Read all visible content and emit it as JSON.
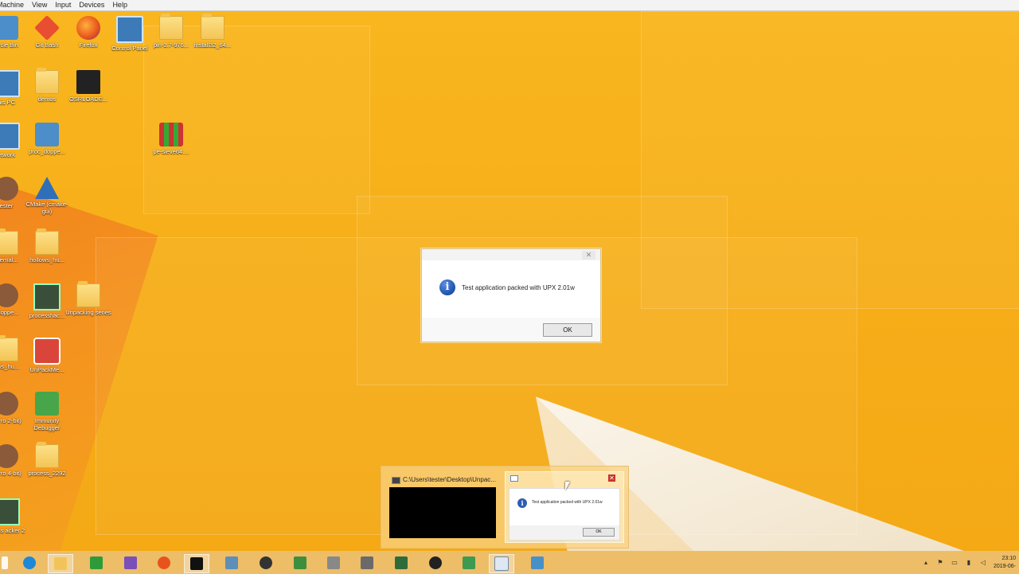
{
  "vm_menu": [
    "Machine",
    "View",
    "Input",
    "Devices",
    "Help"
  ],
  "desktop_icons": [
    {
      "label": "cycle Bin",
      "icon": "recycle-bin-icon"
    },
    {
      "label": "Git Bash",
      "icon": "git-icon"
    },
    {
      "label": "Firefox",
      "icon": "firefox-icon"
    },
    {
      "label": "Control Panel",
      "icon": "control-panel-icon"
    },
    {
      "label": "pin-3.7-976...",
      "icon": "folder-icon"
    },
    {
      "label": "install32_64...",
      "icon": "folder-icon"
    },
    {
      "label": "his PC",
      "icon": "this-pc-icon"
    },
    {
      "label": "demos",
      "icon": "folder-icon"
    },
    {
      "label": "OSRLOADE...",
      "icon": "osrloader-icon"
    },
    {
      "label": "etwork",
      "icon": "network-icon"
    },
    {
      "label": "proc_doppe...",
      "icon": "app-icon"
    },
    {
      "label": "pe-sieve64....",
      "icon": "pe-sieve-icon"
    },
    {
      "label": "ester",
      "icon": "user-icon"
    },
    {
      "label": "CMake (cmake-gui)",
      "icon": "cmake-icon"
    },
    {
      "label": "nternal...",
      "icon": "folder-icon"
    },
    {
      "label": "hollows_hu...",
      "icon": "folder-icon"
    },
    {
      "label": "_doppe...",
      "icon": "ida-icon"
    },
    {
      "label": "processhac...",
      "icon": "processhacker-icon"
    },
    {
      "label": "Unpacking series",
      "icon": "folder-icon"
    },
    {
      "label": "ows_hu...",
      "icon": "folder-icon"
    },
    {
      "label": "UnPackMe...",
      "icon": "unpackme-icon"
    },
    {
      "label": "A Pro 2-bit)",
      "icon": "ida-icon"
    },
    {
      "label": "Immunity Debugger",
      "icon": "immunity-icon"
    },
    {
      "label": "A Pro 4-bit)",
      "icon": "ida-icon"
    },
    {
      "label": "process_2292",
      "icon": "folder-icon"
    },
    {
      "label": "ocess acker 2",
      "icon": "processhacker-icon"
    }
  ],
  "dialog": {
    "message": "Test application packed with UPX 2.01w",
    "ok_label": "OK",
    "close_symbol": "✕",
    "info_symbol": "i"
  },
  "preview": {
    "console_title": "C:\\Users\\tester\\Desktop\\Unpac...",
    "msg_title": "",
    "close_symbol": "✕",
    "mini_message": "Test application packed with UPX 2.01w",
    "mini_ok": "OK"
  },
  "taskbar": {
    "time": "23:10",
    "date": "2019-06-"
  },
  "colors": {
    "desktop": "#f7b21c",
    "accent_orange": "#f07d1e"
  }
}
